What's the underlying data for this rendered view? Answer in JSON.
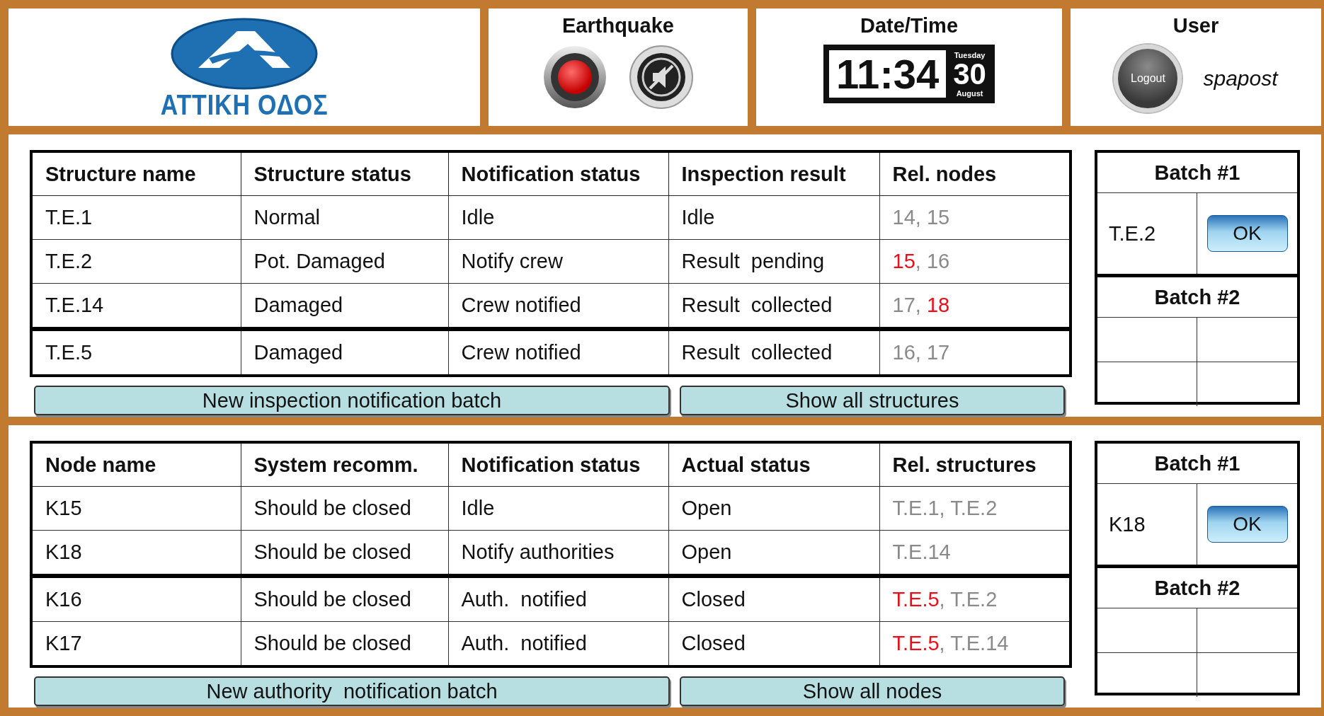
{
  "header": {
    "logo_text": "ΑΤΤΙΚΗ ΟΔΟΣ",
    "earthquake": {
      "title": "Earthquake"
    },
    "datetime": {
      "title": "Date/Time",
      "time": "11:34",
      "weekday": "Tuesday",
      "day": "30",
      "month": "August"
    },
    "user": {
      "title": "User",
      "logout": "Logout",
      "username": "spapost"
    }
  },
  "sections": [
    {
      "columns": [
        "Structure name",
        "Structure status",
        "Notification status",
        "Inspection result",
        "Rel. nodes"
      ],
      "rows": [
        {
          "separated": false,
          "cells": [
            "T.E.1",
            "Normal",
            "Idle",
            "Idle"
          ],
          "related": [
            {
              "text": "14",
              "alert": false
            },
            {
              "text": ", ",
              "alert": false
            },
            {
              "text": "15",
              "alert": false
            }
          ]
        },
        {
          "separated": false,
          "cells": [
            "T.E.2",
            "Pot. Damaged",
            "Notify crew",
            "Result  pending"
          ],
          "related": [
            {
              "text": "15",
              "alert": true
            },
            {
              "text": ", ",
              "alert": false
            },
            {
              "text": "16",
              "alert": false
            }
          ]
        },
        {
          "separated": false,
          "cells": [
            "T.E.14",
            "Damaged",
            "Crew notified",
            "Result  collected"
          ],
          "related": [
            {
              "text": "17",
              "alert": false
            },
            {
              "text": ", ",
              "alert": false
            },
            {
              "text": "18",
              "alert": true
            }
          ]
        },
        {
          "separated": true,
          "cells": [
            "T.E.5",
            "Damaged",
            "Crew notified",
            "Result  collected"
          ],
          "related": [
            {
              "text": "16",
              "alert": false
            },
            {
              "text": ", ",
              "alert": false
            },
            {
              "text": "17",
              "alert": false
            }
          ]
        }
      ],
      "buttons": [
        "New inspection notification batch",
        "Show all structures"
      ],
      "batches": [
        {
          "title": "Batch #1",
          "rows": [
            {
              "kind": "entry",
              "name": "T.E.2",
              "action": "OK"
            }
          ]
        },
        {
          "title": "Batch #2",
          "rows": [
            {
              "kind": "empty"
            },
            {
              "kind": "empty"
            }
          ]
        }
      ]
    },
    {
      "columns": [
        "Node name",
        "System recomm.",
        "Notification status",
        "Actual status",
        "Rel. structures"
      ],
      "rows": [
        {
          "separated": false,
          "cells": [
            "K15",
            "Should be closed",
            "Idle",
            "Open"
          ],
          "related": [
            {
              "text": "T.E.1",
              "alert": false
            },
            {
              "text": ", ",
              "alert": false
            },
            {
              "text": "T.E.2",
              "alert": false
            }
          ]
        },
        {
          "separated": false,
          "cells": [
            "K18",
            "Should be closed",
            "Notify authorities",
            "Open"
          ],
          "related": [
            {
              "text": "T.E.14",
              "alert": false
            }
          ]
        },
        {
          "separated": true,
          "cells": [
            "K16",
            "Should be closed",
            "Auth.  notified",
            "Closed"
          ],
          "related": [
            {
              "text": "T.E.5",
              "alert": true
            },
            {
              "text": ", ",
              "alert": false
            },
            {
              "text": "T.E.2",
              "alert": false
            }
          ]
        },
        {
          "separated": false,
          "cells": [
            "K17",
            "Should be closed",
            "Auth.  notified",
            "Closed"
          ],
          "related": [
            {
              "text": "T.E.5",
              "alert": true
            },
            {
              "text": ", ",
              "alert": false
            },
            {
              "text": "T.E.14",
              "alert": false
            }
          ]
        }
      ],
      "buttons": [
        "New authority  notification batch",
        "Show all nodes"
      ],
      "batches": [
        {
          "title": "Batch #1",
          "rows": [
            {
              "kind": "entry",
              "name": "K18",
              "action": "OK"
            }
          ]
        },
        {
          "title": "Batch #2",
          "rows": [
            {
              "kind": "empty"
            },
            {
              "kind": "empty"
            }
          ]
        }
      ]
    }
  ]
}
